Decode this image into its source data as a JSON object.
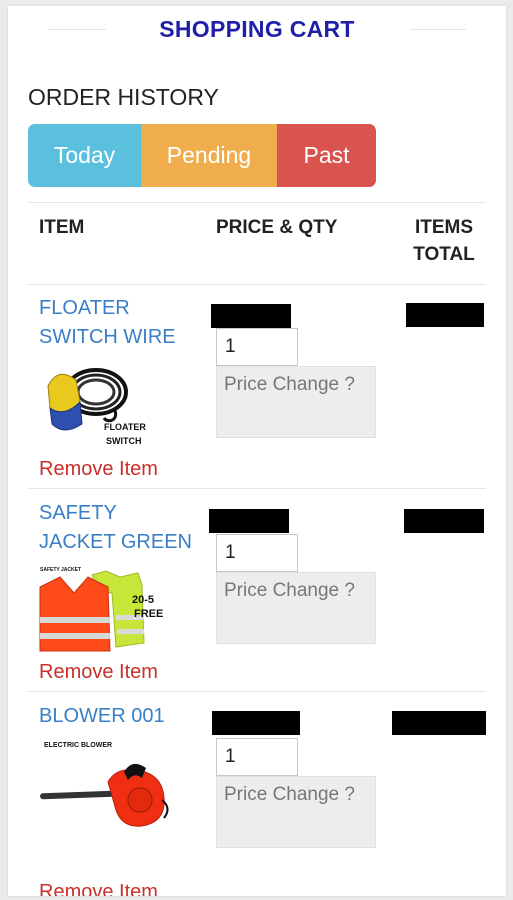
{
  "header": {
    "title": "SHOPPING CART"
  },
  "order_history": {
    "title": "ORDER HISTORY",
    "tabs": [
      {
        "label": "Today",
        "color": "#5bc0de"
      },
      {
        "label": "Pending",
        "color": "#f0ad4e"
      },
      {
        "label": "Past",
        "color": "#d9534f"
      }
    ]
  },
  "table": {
    "headers": {
      "item": "ITEM",
      "price_qty": "PRICE & QTY",
      "items_total_line1": "ITEMS",
      "items_total_line2": "TOTAL"
    },
    "rows": [
      {
        "name_line1": "FLOATER",
        "name_line2": "SWITCH WIRE",
        "image_caption_line1": "FLOATER",
        "image_caption_line2": "SWITCH",
        "quantity": "1",
        "price_change_placeholder": "Price Change ?",
        "remove_label": "Remove Item"
      },
      {
        "name_line1": "SAFETY",
        "name_line2": "JACKET GREEN",
        "image_caption_top": "SAFETY JACKET",
        "image_caption_line1": "20-5",
        "image_caption_line2": "FREE",
        "quantity": "1",
        "price_change_placeholder": "Price Change ?",
        "remove_label": "Remove Item"
      },
      {
        "name_line1": "BLOWER 001",
        "image_caption_top": "ELECTRIC BLOWER",
        "quantity": "1",
        "price_change_placeholder": "Price Change ?",
        "remove_label": "Remove Item"
      }
    ]
  },
  "colors": {
    "title": "#1f1fa8",
    "item_link": "#3a7ec8",
    "remove": "#c9302c",
    "redacted": "#000000"
  }
}
